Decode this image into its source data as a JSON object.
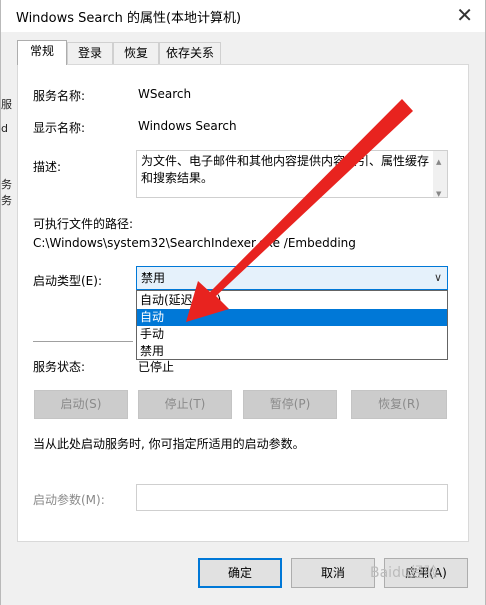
{
  "window": {
    "title": "Windows Search 的属性(本地计算机)",
    "close_glyph": "✕"
  },
  "background_fragments": [
    "服",
    "d",
    "务",
    "务"
  ],
  "tabs": [
    {
      "label": "常规",
      "active": true
    },
    {
      "label": "登录",
      "active": false
    },
    {
      "label": "恢复",
      "active": false
    },
    {
      "label": "依存关系",
      "active": false
    }
  ],
  "general": {
    "service_name_label": "服务名称:",
    "service_name_value": "WSearch",
    "display_name_label": "显示名称:",
    "display_name_value": "Windows Search",
    "description_label": "描述:",
    "description_value": "为文件、电子邮件和其他内容提供内容索引、属性缓存和搜索结果。",
    "path_label": "可执行文件的路径:",
    "path_value": "C:\\Windows\\system32\\SearchIndexer.exe /Embedding",
    "startup_type_label": "启动类型(E):",
    "startup_type_value": "禁用",
    "startup_options": [
      "自动(延迟启动)",
      "自动",
      "手动",
      "禁用"
    ],
    "startup_selected_index": 1,
    "service_status_label": "服务状态:",
    "service_status_value": "已停止",
    "hint_text": "当从此处启动服务时, 你可指定所适用的启动参数。",
    "start_params_label": "启动参数(M):",
    "start_params_value": ""
  },
  "service_buttons": [
    "启动(S)",
    "停止(T)",
    "暂停(P)",
    "恢复(R)"
  ],
  "footer_buttons": {
    "ok": "确定",
    "cancel": "取消",
    "apply": "应用(A)"
  },
  "watermark": "Baidu经验",
  "colors": {
    "accent": "#0078d7",
    "arrow": "#e8231f",
    "disabled_button": "#cccccc"
  },
  "icons": {
    "close": "close-icon",
    "dropdown": "chevron-down-icon",
    "scroll_up": "scroll-up-icon",
    "scroll_down": "scroll-down-icon"
  }
}
